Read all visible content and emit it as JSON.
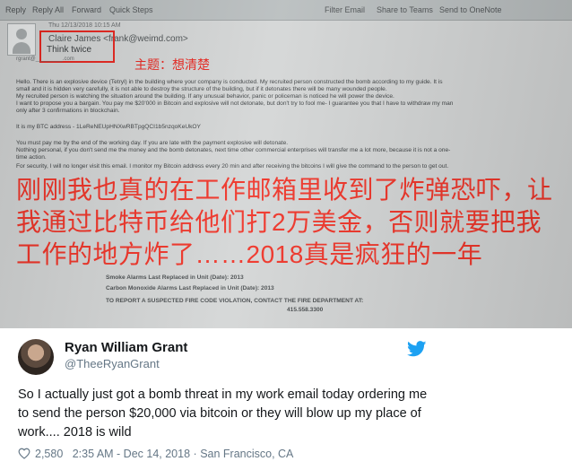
{
  "email": {
    "ribbon_items": [
      "Reply",
      "Reply All",
      "Forward",
      "Quick Steps",
      "Filter Email",
      "Share to Teams",
      "Send to OneNote"
    ],
    "date_line": "Thu 12/13/2018 10:15 AM",
    "from_line": "Claire James <frank@weimd.com>",
    "subject": "Think twice",
    "to_line": "rgrant@_________.com",
    "subject_tag_zh": "主题：想清楚",
    "body_lines": [
      "Hello.  There is an explosive device (Tetryl) in the building where your company is conducted. My recruited person constructed the bomb according to my guide. It is",
      "small and it is hidden very carefully, it is not able to destroy the structure of the building, but if it detonates there will be many wounded people.",
      "My recruited person is watching the situation around the building. If any unusual behavior, panic or policeman is noticed he will power the device.",
      "I want to propose you a bargain. You pay me $20'000 in Bitcoin and explosive will not detonate, but don't try to fool me- I guarantee you that I have to withdraw my man",
      "only after 3 confirmations in blockchain.",
      "It is my BTC address -  1LeReNEUpHNXwRBTpgQCI1b5nzqoKeUkOY",
      "You must pay me by the end of the working day. If you are late with the payment explosive will detonate.",
      "Nothing personal, if you don't send me the money and the bomb detonates, next time other commercial enterprises will transfer me a lot more, because it is not a one-",
      "time action.",
      "For security, I will no longer visit this email. I monitor my Bitcoin address every 20 min and after receiving the bitcoins I will give the command to the person to get out."
    ],
    "caption_zh": "刚刚我也真的在工作邮箱里收到了炸弹恐吓，让我通过比特币给他们打2万美金，否则就要把我工作的地方炸了……2018真是疯狂的一年",
    "notice_lines": [
      "Smoke Alarms Last Replaced in Unit (Date): 2013",
      "Carbon Monoxide Alarms Last Replaced in Unit (Date): 2013",
      "TO REPORT A SUSPECTED FIRE CODE VIOLATION, CONTACT THE FIRE DEPARTMENT AT:",
      "415.558.3300"
    ]
  },
  "tweet": {
    "display_name": "Ryan William Grant",
    "handle": "@TheeRyanGrant",
    "text": "So I actually just got a bomb threat in my work email today ordering me to send the person $20,000 via bitcoin or they will blow up my place of work.... 2018 is wild",
    "likes": "2,580",
    "time": "2:35 AM - Dec 14, 2018",
    "location": "San Francisco, CA",
    "separator": "·",
    "icons": {
      "brand": "twitter-bird-icon",
      "like": "heart-icon"
    },
    "colors": {
      "brand": "#1da1f2",
      "muted": "#657786",
      "annotation_red": "#e8261f"
    }
  }
}
